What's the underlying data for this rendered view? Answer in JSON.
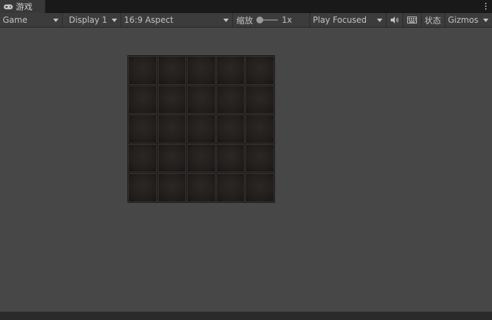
{
  "tab": {
    "label": "游戏",
    "icon": "gamepad-icon"
  },
  "toolbar": {
    "view_mode": "Game",
    "display": "Display 1",
    "aspect": "16:9 Aspect",
    "scale_label": "缩放",
    "scale_value": "1x",
    "play_mode": "Play Focused",
    "stats_label": "状态",
    "gizmos_label": "Gizmos",
    "audio_icon": "speaker-icon",
    "keyboard_icon": "keyboard-icon"
  },
  "board": {
    "rows": 5,
    "cols": 5
  },
  "colors": {
    "viewport_bg": "#474747",
    "toolbar_bg": "#3c3c3c",
    "cell_dark": "#231f1d"
  }
}
